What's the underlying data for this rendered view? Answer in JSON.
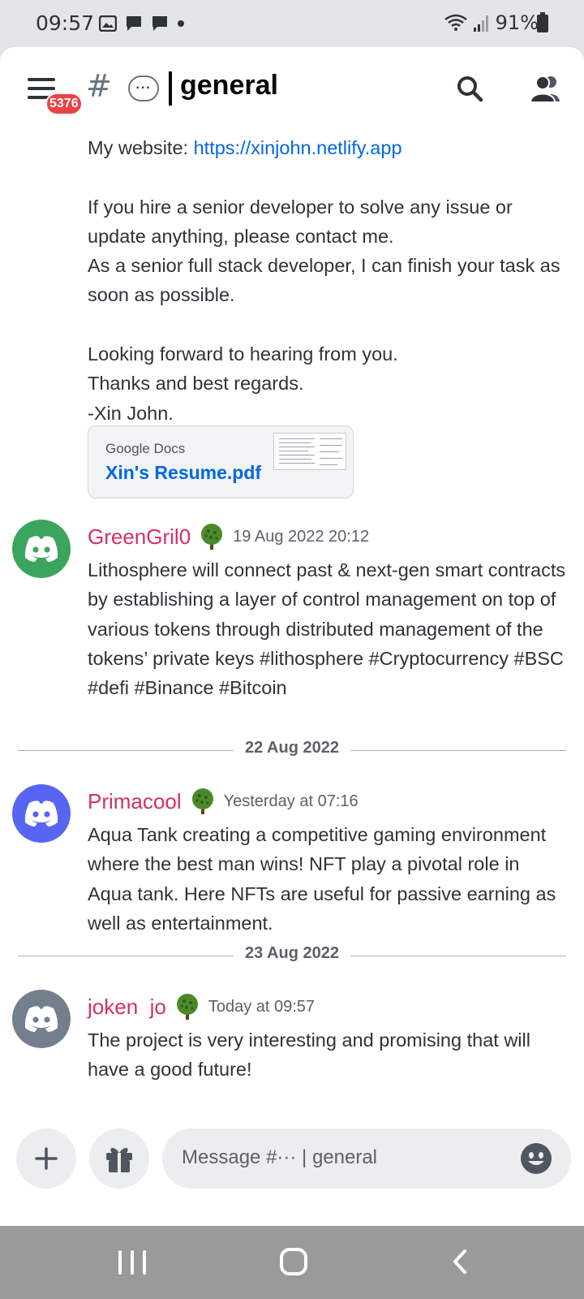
{
  "status_bar": {
    "time": "09:57",
    "battery": "91%"
  },
  "header": {
    "badge": "5376",
    "hash": "#",
    "bubble": "···",
    "channel": "general"
  },
  "top_message": {
    "website_label": "My website: ",
    "website_url": "https://xinjohn.netlify.app",
    "para1": "If you hire a senior developer to solve any issue or update anything, please contact me.",
    "para2": "As a senior full stack developer, I can finish your task as soon as possible.",
    "line1": "Looking forward to hearing from you.",
    "line2": "Thanks and best regards.",
    "line3": "-Xin John.",
    "embed": {
      "provider": "Google Docs",
      "title": "Xin's Resume.pdf"
    }
  },
  "messages": [
    {
      "username": "GreenGril0",
      "timestamp": "19 Aug 2022 20:12",
      "avatar_color": "#3ba55d",
      "text": "Lithosphere will connect past & next-gen smart contracts by establishing a layer of control management on top of various tokens through distributed management of the tokens’ private keys #lithosphere #Cryptocurrency #BSC #defi #Binance #Bitcoin"
    },
    {
      "username": "Primacool",
      "timestamp": "Yesterday at 07:16",
      "avatar_color": "#5865f2",
      "text": "Aqua Tank creating a competitive gaming environment where the best man wins! NFT play a pivotal role in Aqua tank. Here NFTs are useful for passive earning as well as entertainment."
    },
    {
      "username": "joken  jo",
      "timestamp": "Today at 09:57",
      "avatar_color": "#747f8d",
      "text": "The project is very interesting and promising that will have a good future!"
    }
  ],
  "dividers": [
    "22 Aug 2022",
    "23 Aug 2022"
  ],
  "composer": {
    "placeholder": "Message #··· | general"
  },
  "colors": {
    "username": "#d52f66",
    "link": "#0068e0",
    "badge": "#ed4245"
  }
}
